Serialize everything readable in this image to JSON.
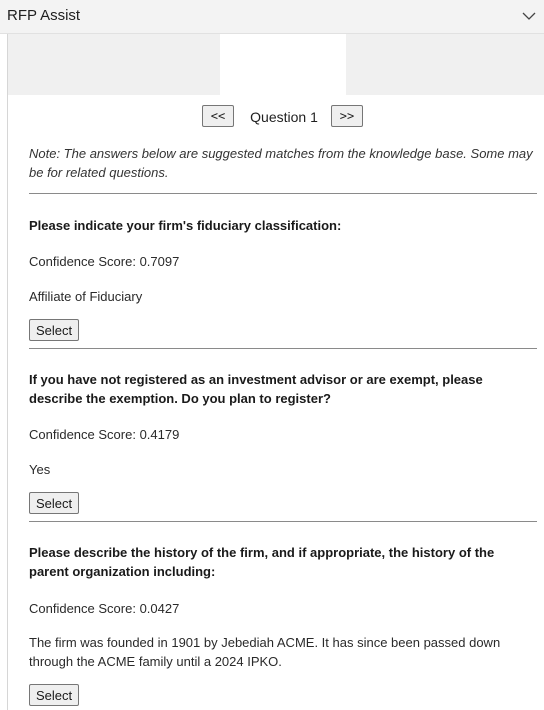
{
  "pane": {
    "title": "RFP Assist",
    "collapse_icon": "chevron-down-icon"
  },
  "nav": {
    "prev_label": "<<",
    "next_label": ">>",
    "question_label": "Question 1"
  },
  "note": "Note: The answers below are suggested matches from the knowledge base. Some may be for related questions.",
  "answers": [
    {
      "question": "Please indicate your firm's fiduciary classification:",
      "confidence": "Confidence Score: 0.7097",
      "answer": "Affiliate of Fiduciary",
      "select_label": "Select"
    },
    {
      "question": "If you have not registered as an investment advisor or are exempt, please describe the exemption. Do you plan to register?",
      "confidence": "Confidence Score: 0.4179",
      "answer": "Yes",
      "select_label": "Select"
    },
    {
      "question": "Please describe the history of the firm, and if appropriate, the history of the parent organization including:",
      "confidence": "Confidence Score: 0.0427",
      "answer": "The firm was founded in 1901 by Jebediah ACME. It has since been passed down through the ACME family until a 2024 IPKO.",
      "select_label": "Select"
    }
  ]
}
